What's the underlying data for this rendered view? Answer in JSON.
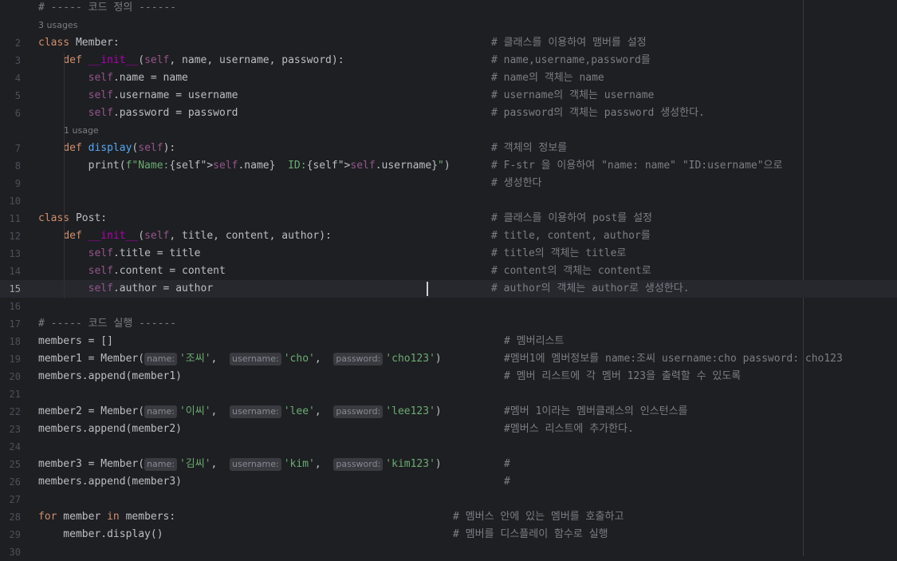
{
  "editor": {
    "lines": [
      {
        "ln": "",
        "code": "",
        "comment": "# ----- 코드 정의 ------",
        "comment_at_code": true
      },
      {
        "ln": "",
        "hint": "3 usages"
      },
      {
        "ln": "2",
        "code": "class Member:",
        "comment": "# 클래스를 이용하여 맴버를 설정"
      },
      {
        "ln": "3",
        "code": "    def __init__(self, name, username, password):",
        "comment": "# name,username,password를"
      },
      {
        "ln": "4",
        "code": "        self.name = name",
        "comment": "# name의 객체는 name"
      },
      {
        "ln": "5",
        "code": "        self.username = username",
        "comment": "# username의 객체는 username"
      },
      {
        "ln": "6",
        "code": "        self.password = password",
        "comment": "# password의 객체는 password 생성한다."
      },
      {
        "ln": "",
        "hint": "1 usage"
      },
      {
        "ln": "7",
        "code": "    def display(self):",
        "comment": "# 객체의 정보를"
      },
      {
        "ln": "8",
        "code": "        print(f\"Name:{self.name}  ID:{self.username}\")",
        "comment": "# F-str 을 이용하여 \"name: name\" \"ID:username\"으로"
      },
      {
        "ln": "9",
        "code": "",
        "comment": "# 생성한다"
      },
      {
        "ln": "10",
        "code": "",
        "comment": ""
      },
      {
        "ln": "11",
        "code": "class Post:",
        "comment": "# 클래스를 이용하여 post를 설정"
      },
      {
        "ln": "12",
        "code": "    def __init__(self, title, content, author):",
        "comment": "# title, content, author를"
      },
      {
        "ln": "13",
        "code": "        self.title = title",
        "comment": "# title의 객체는 title로"
      },
      {
        "ln": "14",
        "code": "        self.content = content",
        "comment": "# content의 객체는 content로"
      },
      {
        "ln": "15",
        "code": "        self.author = author",
        "comment": "# author의 객체는 author로 생성한다.",
        "current": true
      },
      {
        "ln": "16",
        "code": "",
        "comment": ""
      },
      {
        "ln": "17",
        "code": "# ----- 코드 실행 ------",
        "comment": ""
      },
      {
        "ln": "18",
        "code": "members = []",
        "comment": "# 멤버리스트"
      },
      {
        "ln": "19",
        "code": "member1 = Member(",
        "args": [
          [
            "name:",
            "'조씨'"
          ],
          [
            "username:",
            "'cho'"
          ],
          [
            "password:",
            "'cho123'"
          ]
        ],
        "close": ")",
        "comment": "#멤버1에 멤버정보를 name:조씨 username:cho password: cho123"
      },
      {
        "ln": "20",
        "code": "members.append(member1)",
        "comment": "# 멤버 리스트에 각 멤버 123을 출력할 수 있도록"
      },
      {
        "ln": "21",
        "code": "",
        "comment": ""
      },
      {
        "ln": "22",
        "code": "member2 = Member(",
        "args": [
          [
            "name:",
            "'이씨'"
          ],
          [
            "username:",
            "'lee'"
          ],
          [
            "password:",
            "'lee123'"
          ]
        ],
        "close": ")",
        "comment": "#멤버 1이라는 멤버클래스의 인스턴스를"
      },
      {
        "ln": "23",
        "code": "members.append(member2)",
        "comment": "#멤버스 리스트에 추가한다."
      },
      {
        "ln": "24",
        "code": "",
        "comment": ""
      },
      {
        "ln": "25",
        "code": "member3 = Member(",
        "args": [
          [
            "name:",
            "'김씨'"
          ],
          [
            "username:",
            "'kim'"
          ],
          [
            "password:",
            "'kim123'"
          ]
        ],
        "close": ")",
        "comment": "#"
      },
      {
        "ln": "26",
        "code": "members.append(member3)",
        "comment": "#"
      },
      {
        "ln": "27",
        "code": "",
        "comment": ""
      },
      {
        "ln": "28",
        "code": "for member in members:",
        "comment": "# 멤버스 안에 있는 멤버를 호출하고"
      },
      {
        "ln": "29",
        "code": "    member.display()",
        "comment": "# 멤버를 디스플레이 함수로 실행"
      },
      {
        "ln": "30",
        "code": "",
        "comment": ""
      }
    ]
  }
}
